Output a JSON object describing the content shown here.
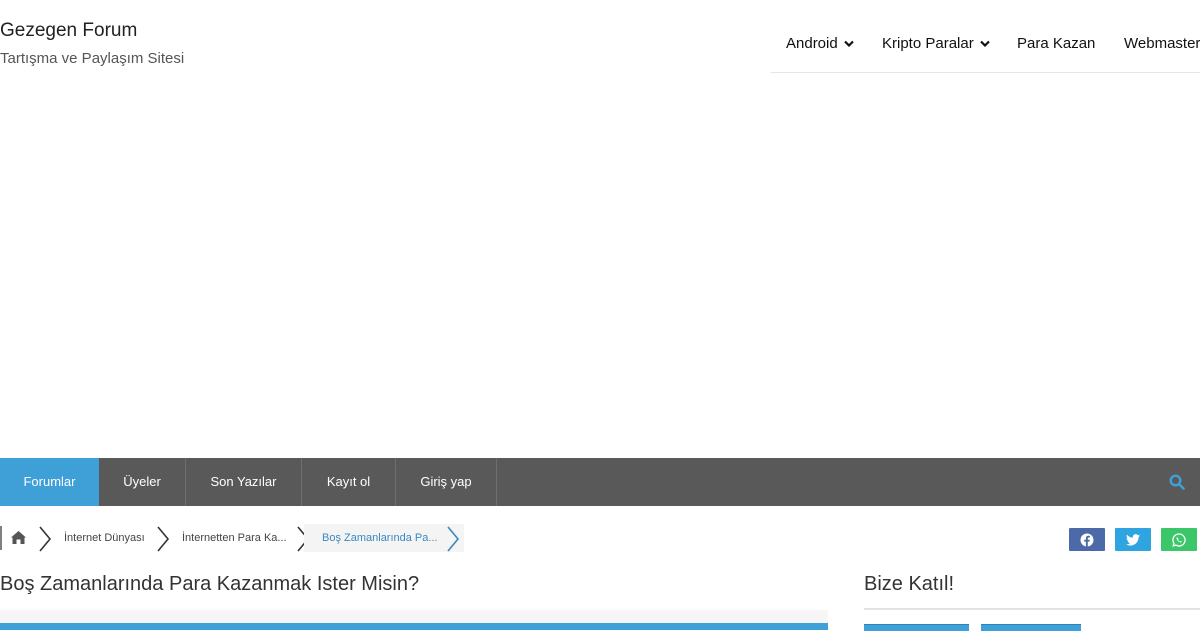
{
  "site": {
    "title": "Gezegen Forum",
    "tagline": "Tartışma ve Paylaşım Sitesi"
  },
  "top_nav": [
    {
      "label": "Android",
      "has_dropdown": true
    },
    {
      "label": "Kripto Paralar",
      "has_dropdown": true
    },
    {
      "label": "Para Kazan",
      "has_dropdown": false
    },
    {
      "label": "Webmaster",
      "has_dropdown": false
    }
  ],
  "main_nav": {
    "items": [
      {
        "label": "Forumlar",
        "active": true
      },
      {
        "label": "Üyeler",
        "active": false
      },
      {
        "label": "Son Yazılar",
        "active": false
      },
      {
        "label": "Kayıt ol",
        "active": false
      },
      {
        "label": "Giriş yap",
        "active": false
      }
    ],
    "search_icon": "search-icon"
  },
  "breadcrumb": {
    "home_icon": "home-icon",
    "items": [
      "İnternet Dünyası",
      "İnternetten Para Ka...",
      "Boş Zamanlarında Pa..."
    ]
  },
  "share": {
    "icons": [
      "facebook-icon",
      "twitter-icon",
      "whatsapp-icon"
    ]
  },
  "thread": {
    "title": "Boş Zamanlarında Para Kazanmak Ister Misin?"
  },
  "sidebar": {
    "title": "Bize Katıl!"
  },
  "colors": {
    "accent": "#3fa0d7",
    "nav_bg": "#595959",
    "facebook": "#4c6aa8",
    "twitter": "#2ea5e0",
    "whatsapp": "#3cc66a"
  }
}
